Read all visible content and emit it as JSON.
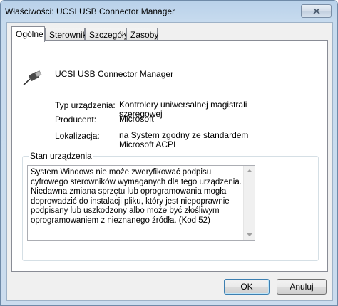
{
  "window": {
    "title": "Właściwości: UCSI USB Connector Manager",
    "close_icon": "close-icon"
  },
  "tabs": [
    {
      "label": "Ogólne",
      "active": true
    },
    {
      "label": "Sterownik",
      "active": false
    },
    {
      "label": "Szczegóły",
      "active": false
    },
    {
      "label": "Zasoby",
      "active": false
    }
  ],
  "device": {
    "icon": "usb-connector-icon",
    "name": "UCSI USB Connector Manager"
  },
  "properties": [
    {
      "label": "Typ urządzenia:",
      "value": "Kontrolery uniwersalnej magistrali szeregowej"
    },
    {
      "label": "Producent:",
      "value": "Microsoft"
    },
    {
      "label": "Lokalizacja:",
      "value": "na System zgodny ze standardem Microsoft ACPI"
    }
  ],
  "status": {
    "legend": "Stan urządzenia",
    "text": "System Windows nie może zweryfikować podpisu cyfrowego sterowników wymaganych dla tego urządzenia. Niedawna zmiana sprzętu lub oprogramowania mogła doprowadzić do instalacji pliku, który jest niepoprawnie podpisany lub uszkodzony albo może być złośliwym oprogramowaniem z nieznanego źródła. (Kod 52)"
  },
  "buttons": {
    "ok": "OK",
    "cancel": "Anuluj"
  }
}
